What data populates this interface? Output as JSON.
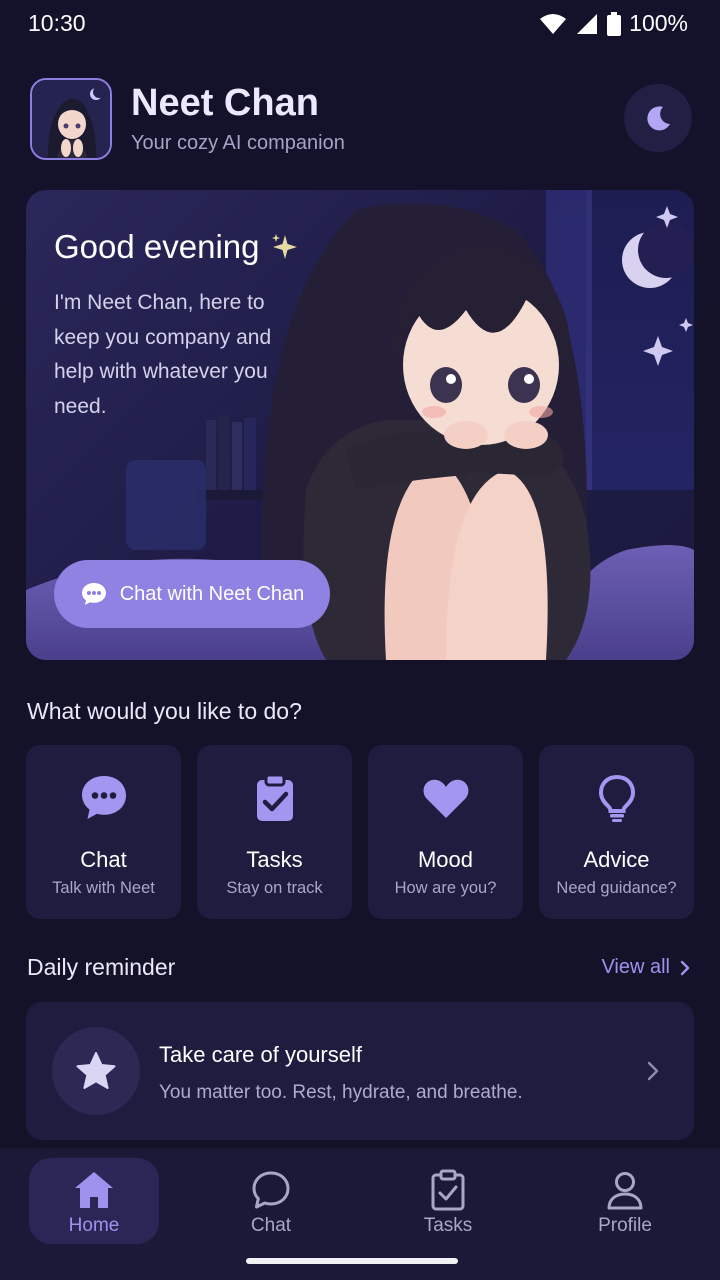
{
  "status_bar": {
    "time": "10:30",
    "battery": "100%"
  },
  "header": {
    "title": "Neet Chan",
    "subtitle": "Your cozy AI companion"
  },
  "hero": {
    "greeting": "Good evening",
    "message": "I'm Neet Chan, here to keep you company and help with whatever you need.",
    "cta_label": "Chat with Neet Chan"
  },
  "actions_section": {
    "title": "What would you like to do?",
    "items": [
      {
        "title": "Chat",
        "subtitle": "Talk with Neet",
        "icon": "chat-bubble-icon"
      },
      {
        "title": "Tasks",
        "subtitle": "Stay on track",
        "icon": "clipboard-check-icon"
      },
      {
        "title": "Mood",
        "subtitle": "How are you?",
        "icon": "heart-icon"
      },
      {
        "title": "Advice",
        "subtitle": "Need guidance?",
        "icon": "lightbulb-icon"
      }
    ]
  },
  "reminder_section": {
    "title": "Daily reminder",
    "view_all": "View all",
    "card": {
      "title": "Take care of yourself",
      "subtitle": "You matter too. Rest, hydrate, and breathe."
    }
  },
  "bottom_nav": {
    "items": [
      {
        "label": "Home",
        "active": true
      },
      {
        "label": "Chat",
        "active": false
      },
      {
        "label": "Tasks",
        "active": false
      },
      {
        "label": "Profile",
        "active": false
      }
    ]
  },
  "colors": {
    "accent": "#8f82e3",
    "background": "#131227",
    "card": "#1f1d3f"
  }
}
